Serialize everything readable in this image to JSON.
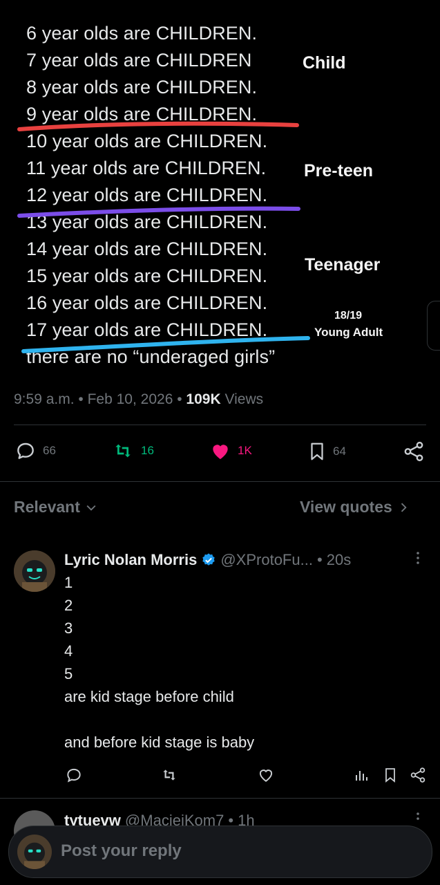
{
  "post": {
    "lines": [
      "6 year olds are CHILDREN.",
      "7 year olds are CHILDREN",
      "8 year olds are CHILDREN.",
      "9 year olds are CHILDREN.",
      "10 year olds are CHILDREN.",
      "11 year olds are CHILDREN.",
      "12 year olds are CHILDREN.",
      "13 year olds are CHILDREN.",
      "14 year olds are CHILDREN.",
      "15 year olds are CHILDREN.",
      "16 year olds are CHILDREN.",
      "17 year olds are CHILDREN.",
      "there are no “underaged girls”"
    ],
    "annotations": {
      "child": "Child",
      "preteen": "Pre-teen",
      "teenager": "Teenager",
      "adult_age": "18/19",
      "adult": "Young Adult"
    },
    "underline_colors": {
      "red": "#e8413f",
      "purple": "#7b4de8",
      "blue": "#2fb3ee"
    },
    "time": "9:59 a.m.",
    "date": "Feb 10, 2026",
    "views_count": "109K",
    "views_label": "Views",
    "sep": "•"
  },
  "actions": {
    "replies": "66",
    "reposts": "16",
    "likes": "1K",
    "bookmarks": "64"
  },
  "colors": {
    "repost": "#00ba7c",
    "like": "#f91880",
    "verified": "#1d9bf0",
    "muted": "#71767b"
  },
  "sort": {
    "label": "Relevant",
    "view_quotes": "View quotes"
  },
  "reply": {
    "name": "Lyric Nolan Morris",
    "handle": "@XProtoFu...",
    "time": "• 20s",
    "lines": [
      "1",
      "2",
      "3",
      "4",
      "5",
      "are kid stage before child",
      "",
      "and before kid stage is baby"
    ]
  },
  "next_reply": {
    "name": "tytuevw",
    "handle": "@MaciejKom7",
    "time": "• 1h"
  },
  "composer": {
    "placeholder": "Post your reply"
  }
}
